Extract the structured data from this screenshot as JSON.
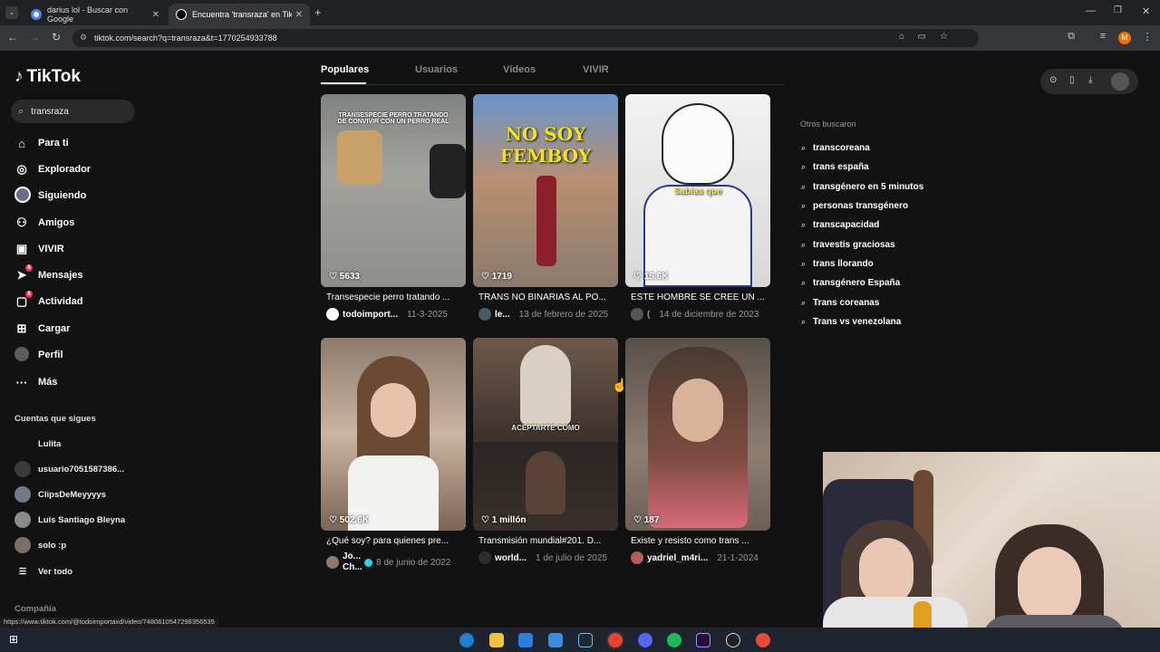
{
  "browser": {
    "tabs": [
      {
        "title": "darius lol - Buscar con Google"
      },
      {
        "title": "Encuentra 'transraza' en TikTok"
      }
    ],
    "url": "tiktok.com/search?q=transraza&t=1770254933788",
    "profile_initial": "M"
  },
  "sidebar": {
    "brand": "TikTok",
    "search_value": "transraza",
    "nav": [
      {
        "label": "Para ti",
        "icon": "home-icon"
      },
      {
        "label": "Explorador",
        "icon": "compass-icon"
      },
      {
        "label": "Siguiendo",
        "icon": "following-avatar"
      },
      {
        "label": "Amigos",
        "icon": "friends-icon"
      },
      {
        "label": "VIVIR",
        "icon": "live-icon"
      },
      {
        "label": "Mensajes",
        "icon": "messages-icon",
        "badge": "8"
      },
      {
        "label": "Actividad",
        "icon": "activity-icon",
        "badge": "8"
      },
      {
        "label": "Cargar",
        "icon": "upload-icon"
      },
      {
        "label": "Perfil",
        "icon": "profile-avatar"
      },
      {
        "label": "Más",
        "icon": "more-icon"
      }
    ],
    "following_title": "Cuentas que sigues",
    "following": [
      {
        "name": "Lulita"
      },
      {
        "name": "usuario7051587386..."
      },
      {
        "name": "ClipsDeMeyyyys"
      },
      {
        "name": "Luis Santiago Bleyna"
      },
      {
        "name": "solo :p"
      }
    ],
    "see_all": "Ver todo",
    "company": "Compañía"
  },
  "tabs": [
    "Populares",
    "Usuarios",
    "Vídeos",
    "VIVIR"
  ],
  "videos": [
    {
      "likes": "5633",
      "title": "Transespecie perro tratando ...",
      "user": "todoimport...",
      "date": "11-3-2025",
      "overlay": "TRANSESPECIE PERRO TRATANDO DE CONVIVIR CON UN PERRO REAL",
      "bg": "#8c8f8e"
    },
    {
      "likes": "1719",
      "title": "TRANS NO BINARIAS AL PO...",
      "user": "le...",
      "date": "13 de febrero de 2025",
      "overlay": "NO SOY FEMBOY",
      "bg": "#9a7d69"
    },
    {
      "likes": "15.6K",
      "title": "ESTE HOMBRE SE CREE UN ...",
      "user": "(",
      "date": "14 de diciembre de 2023",
      "overlay": "Sabías que",
      "bg": "#d9d9d9"
    },
    {
      "likes": "502.6K",
      "title": "¿Qué soy? para quienes pre...",
      "user": "Jo... Ch...",
      "date": "8 de junio de 2022",
      "overlay": "",
      "bg": "#b49a86"
    },
    {
      "likes": "1 millón",
      "title": "Transmisión mundial#201. D...",
      "user": "world...",
      "date": "1 de julio de 2025",
      "overlay": "ACEPTARTE COMO",
      "bg": "#3a2f2a"
    },
    {
      "likes": "187",
      "title": "Existe y resisto como trans ...",
      "user": "yadriel_m4ri...",
      "date": "21-1-2024",
      "overlay": "",
      "bg": "#7a6b62"
    }
  ],
  "others": {
    "title": "Otros buscaron",
    "items": [
      "transcoreana",
      "trans españa",
      "transgénero en 5 minutos",
      "personas transgénero",
      "transcapacidad",
      "travestis graciosas",
      "trans llorando",
      "transgénero España",
      "Trans coreanas",
      "Trans vs venezolana"
    ]
  },
  "status_url": "https://www.tiktok.com/@todoimportaxd/video/7480610547298356535"
}
